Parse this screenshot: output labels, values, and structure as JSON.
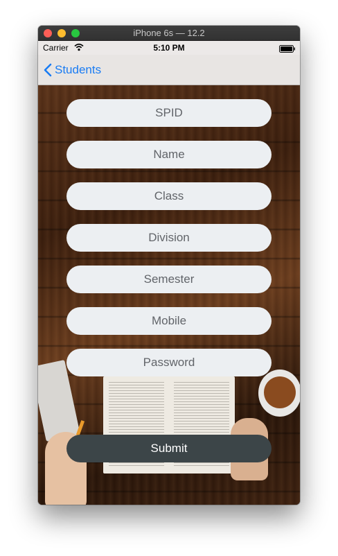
{
  "window": {
    "title": "iPhone 6s — 12.2"
  },
  "statusbar": {
    "carrier": "Carrier",
    "time": "5:10 PM",
    "wifi_icon": "wifi-icon",
    "battery_icon": "battery-icon"
  },
  "navbar": {
    "back_label": "Students",
    "back_icon": "chevron-left-icon",
    "accent_color": "#1a7cf3"
  },
  "form": {
    "fields": [
      {
        "placeholder": "SPID",
        "value": ""
      },
      {
        "placeholder": "Name",
        "value": ""
      },
      {
        "placeholder": "Class",
        "value": ""
      },
      {
        "placeholder": "Division",
        "value": ""
      },
      {
        "placeholder": "Semester",
        "value": ""
      },
      {
        "placeholder": "Mobile",
        "value": ""
      },
      {
        "placeholder": "Password",
        "value": ""
      }
    ],
    "submit_label": "Submit",
    "field_color": "#eceff2",
    "submit_color": "#3c4548"
  }
}
